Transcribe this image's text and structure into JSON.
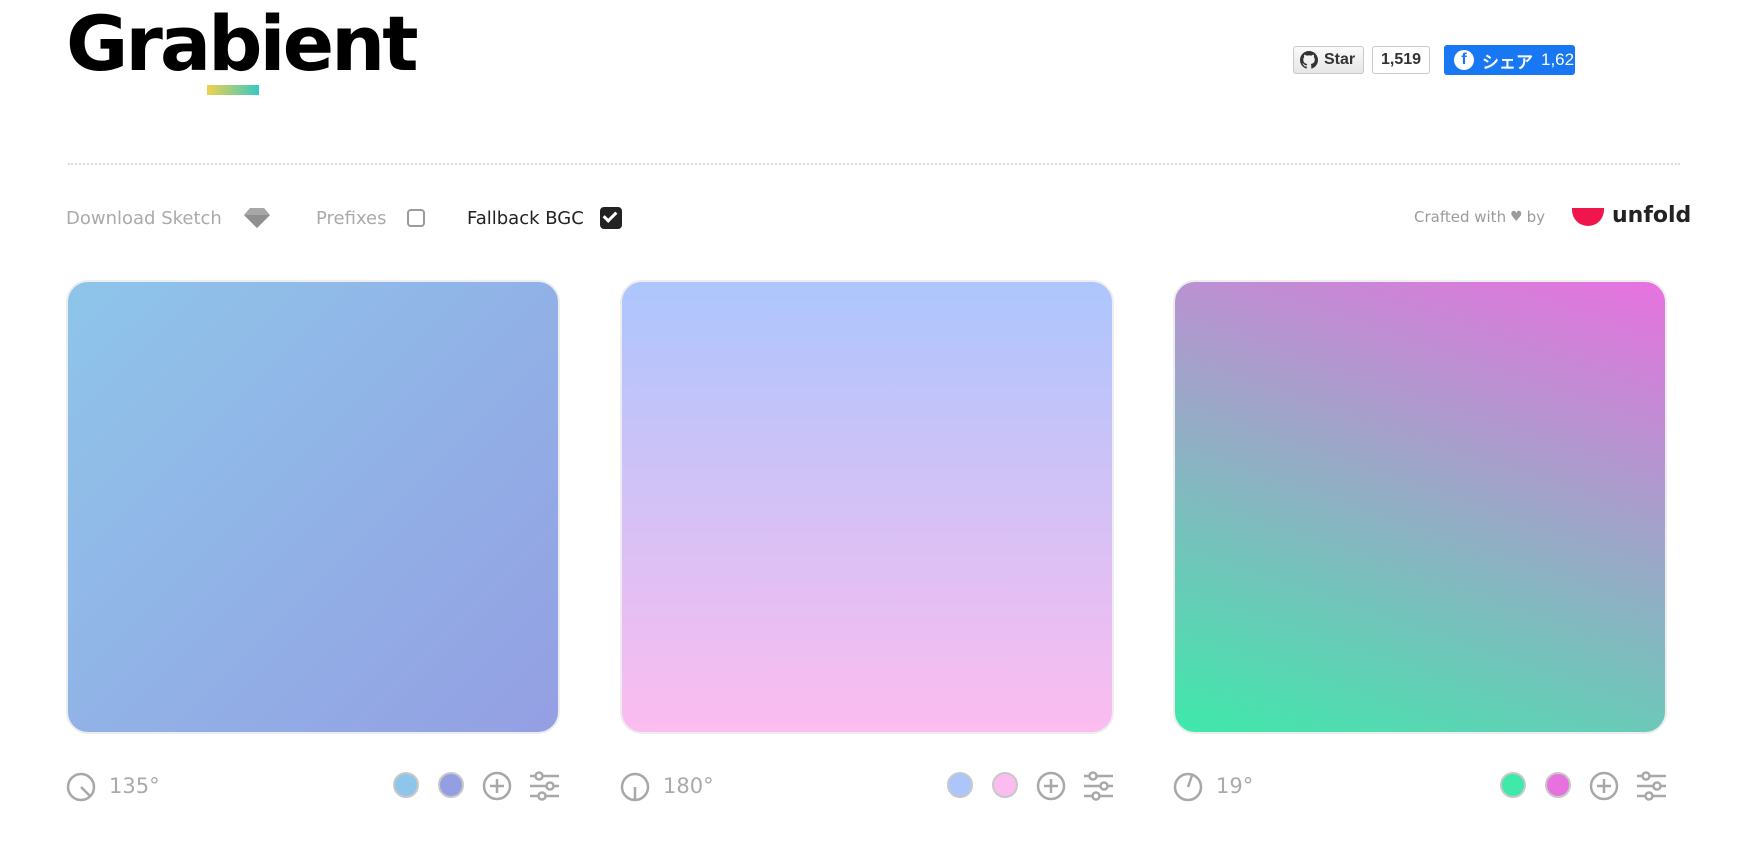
{
  "header": {
    "logo_text": "Grabient",
    "github": {
      "star_label": "Star",
      "star_count": "1,519"
    },
    "facebook": {
      "logo_glyph": "f",
      "share_label": "シェア",
      "share_count": "1,62"
    }
  },
  "toolbar": {
    "download_sketch_label": "Download Sketch",
    "prefixes_label": "Prefixes",
    "prefixes_checked": false,
    "fallback_label": "Fallback BGC",
    "fallback_checked": true,
    "crafted_prefix": "Crafted with",
    "heart_glyph": "♥",
    "crafted_suffix": "by",
    "brand": "unfold"
  },
  "gradients": [
    {
      "angle_label": "135°",
      "angle": 135,
      "stops": [
        "#8ec5ea",
        "#949fe3"
      ]
    },
    {
      "angle_label": "180°",
      "angle": 180,
      "stops": [
        "#acc6fd",
        "#fcbcef"
      ]
    },
    {
      "angle_label": "19°",
      "angle": 19,
      "stops": [
        "#3ee9aa",
        "#e871e0"
      ]
    }
  ],
  "colors": {
    "muted": "#aaaaaa",
    "unfold_brand": "#f0154d",
    "facebook": "#1877f2"
  }
}
